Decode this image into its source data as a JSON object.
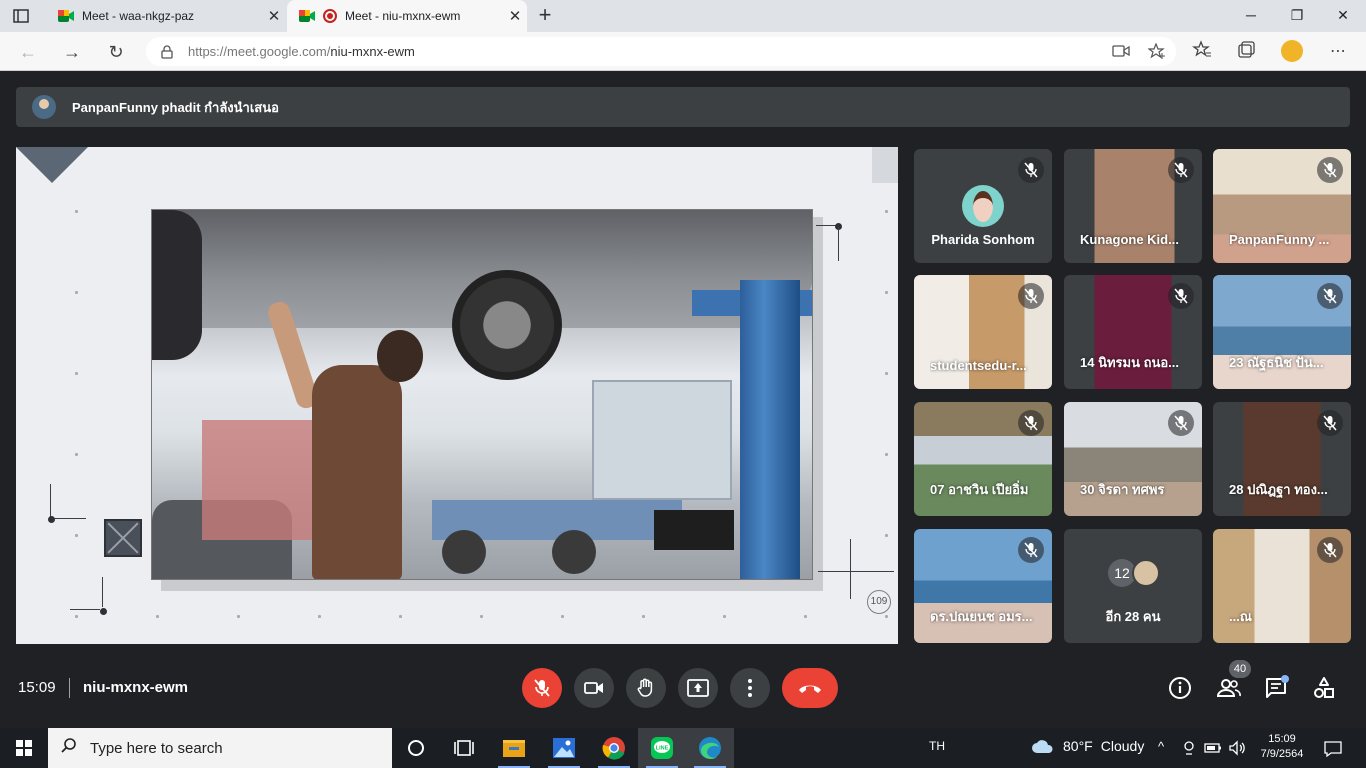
{
  "browser": {
    "tabs": [
      {
        "title": "Meet - waa-nkgz-paz",
        "active": false
      },
      {
        "title": "Meet - niu-mxnx-ewm",
        "active": true,
        "recording": true
      }
    ],
    "close_glyph": "✕",
    "newtab_glyph": "+",
    "window_controls": {
      "minimize": "─",
      "restore": "❐",
      "close": "✕"
    },
    "nav": {
      "back": "←",
      "forward": "→",
      "reload": "↻"
    },
    "url": {
      "host": "https://meet.google.com/",
      "path": "niu-mxnx-ewm"
    },
    "menu_glyph": "⋯"
  },
  "presenter_banner": {
    "text": "PanpanFunny phadit กำลังนำเสนอ"
  },
  "presentation": {
    "page_number": "109"
  },
  "participants": [
    {
      "name": "Pharida Sonhom",
      "muted": true,
      "display": "avatar"
    },
    {
      "name": "Kunagone Kid...",
      "muted": true,
      "display": "video"
    },
    {
      "name": "PanpanFunny ...",
      "muted": true,
      "display": "video"
    },
    {
      "name": "studentsedu-r...",
      "muted": true,
      "display": "video"
    },
    {
      "name": "14 นิทรมน ถนอ...",
      "muted": true,
      "display": "video"
    },
    {
      "name": "23 ณัฐธนิช ปัน...",
      "muted": true,
      "display": "video"
    },
    {
      "name": "07 อาชวิน เปียอิ่ม",
      "muted": true,
      "display": "video"
    },
    {
      "name": "30 จิรดา ทศพร",
      "muted": true,
      "display": "video"
    },
    {
      "name": "28 ปณิฎฐา ทอง...",
      "muted": true,
      "display": "video"
    },
    {
      "name": "ดร.ปณยนช อมร...",
      "muted": true,
      "display": "video"
    },
    {
      "name": "อีก 28 คน",
      "muted": false,
      "display": "more",
      "count_label": "12"
    },
    {
      "name": "...ณ",
      "muted": true,
      "display": "video"
    }
  ],
  "meeting": {
    "time": "15:09",
    "code": "niu-mxnx-ewm",
    "participant_count": "40",
    "colors": {
      "hangup": "#ea4335",
      "mic_off": "#ea4335",
      "button": "#3c4043"
    }
  },
  "taskbar": {
    "search_placeholder": "Type here to search",
    "language": "TH",
    "weather": {
      "temp": "80°F",
      "condition": "Cloudy"
    },
    "clock": {
      "time": "15:09",
      "date": "7/9/2564"
    },
    "apps": [
      "cortana-icon",
      "task-view-icon",
      "file-explorer-icon",
      "photos-icon",
      "chrome-icon",
      "line-icon",
      "edge-icon"
    ]
  }
}
